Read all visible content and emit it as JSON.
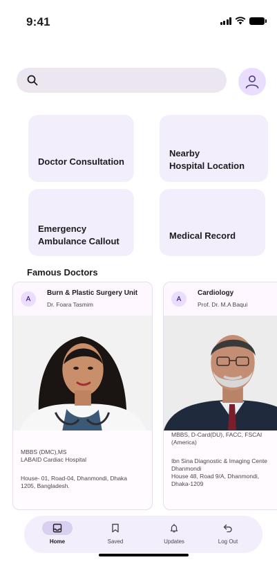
{
  "status_bar": {
    "time": "9:41"
  },
  "search": {
    "placeholder": ""
  },
  "services": [
    {
      "label": "Doctor Consultation"
    },
    {
      "label": "Nearby\nHospital Location"
    },
    {
      "label": "Emergency\nAmbulance Callout"
    },
    {
      "label": "Medical Record"
    }
  ],
  "famous_doctors": {
    "title": "Famous Doctors",
    "doctors": [
      {
        "badge": "A",
        "department": "Burn & Plastic Surgery Unit",
        "name": "Dr. Foara Tasmim",
        "degrees": "MBBS (DMC),MS",
        "hospital": "LABAID Cardiac Hospital",
        "address_line1": "House- 01, Road-04, Dhanmondi, Dhaka",
        "address_line2": "1205, Bangladesh."
      },
      {
        "badge": "A",
        "department": "Cardiology",
        "name": "Prof. Dr. M.A Baqui",
        "degrees_line1": "MBBS, D-Card(DU), FACC, FSCAI",
        "degrees_line2": "(America)",
        "hospital_line1": "Ibn Sina Diagnostic & Imaging Cente",
        "hospital_line2": "Dhanmondi",
        "address_line1": "House 48, Road 9/A, Dhanmondi,",
        "address_line2": "Dhaka-1209"
      }
    ]
  },
  "nav": {
    "items": [
      {
        "label": "Home",
        "icon": "inbox-icon",
        "active": true
      },
      {
        "label": "Saved",
        "icon": "bookmark-icon",
        "active": false
      },
      {
        "label": "Updates",
        "icon": "bell-icon",
        "active": false
      },
      {
        "label": "Log Out",
        "icon": "undo-icon",
        "active": false
      }
    ]
  },
  "colors": {
    "card_background": "#f3eefb",
    "search_background": "#ece6f0",
    "avatar_background": "#eaddff",
    "active_pill": "#d9d0f0"
  }
}
